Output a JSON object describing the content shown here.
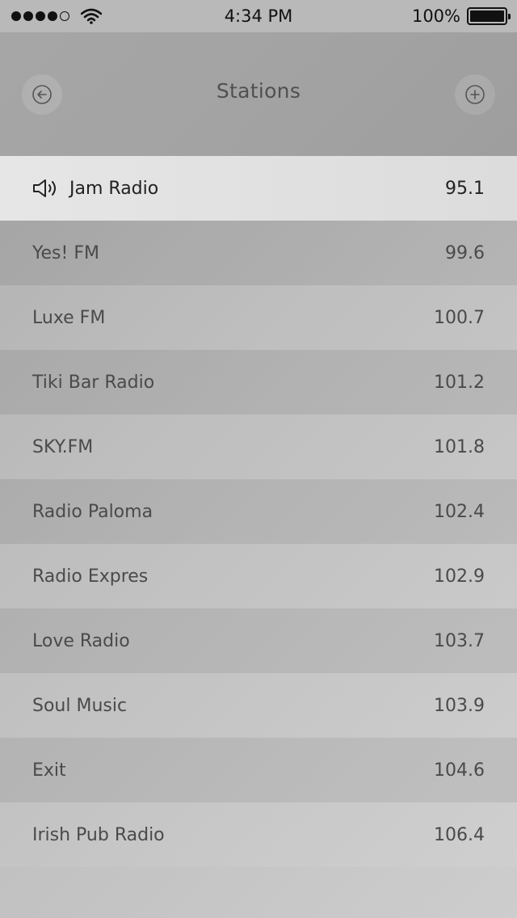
{
  "status_bar": {
    "time": "4:34 PM",
    "battery": "100%",
    "signal_bars_filled": 4,
    "signal_bars_total": 5
  },
  "header": {
    "title": "Stations",
    "back_icon": "arrow-left-circle-icon",
    "add_icon": "plus-circle-icon"
  },
  "stations": [
    {
      "name": "Jam Radio",
      "freq": "95.1",
      "playing": true
    },
    {
      "name": "Yes! FM",
      "freq": "99.6"
    },
    {
      "name": "Luxe FM",
      "freq": "100.7"
    },
    {
      "name": "Tiki Bar Radio",
      "freq": "101.2"
    },
    {
      "name": "SKY.FM",
      "freq": "101.8"
    },
    {
      "name": "Radio Paloma",
      "freq": "102.4"
    },
    {
      "name": "Radio Expres",
      "freq": "102.9"
    },
    {
      "name": "Love Radio",
      "freq": "103.7"
    },
    {
      "name": "Soul Music",
      "freq": "103.9"
    },
    {
      "name": "Exit",
      "freq": "104.6"
    },
    {
      "name": "Irish Pub Radio",
      "freq": "106.4"
    }
  ]
}
